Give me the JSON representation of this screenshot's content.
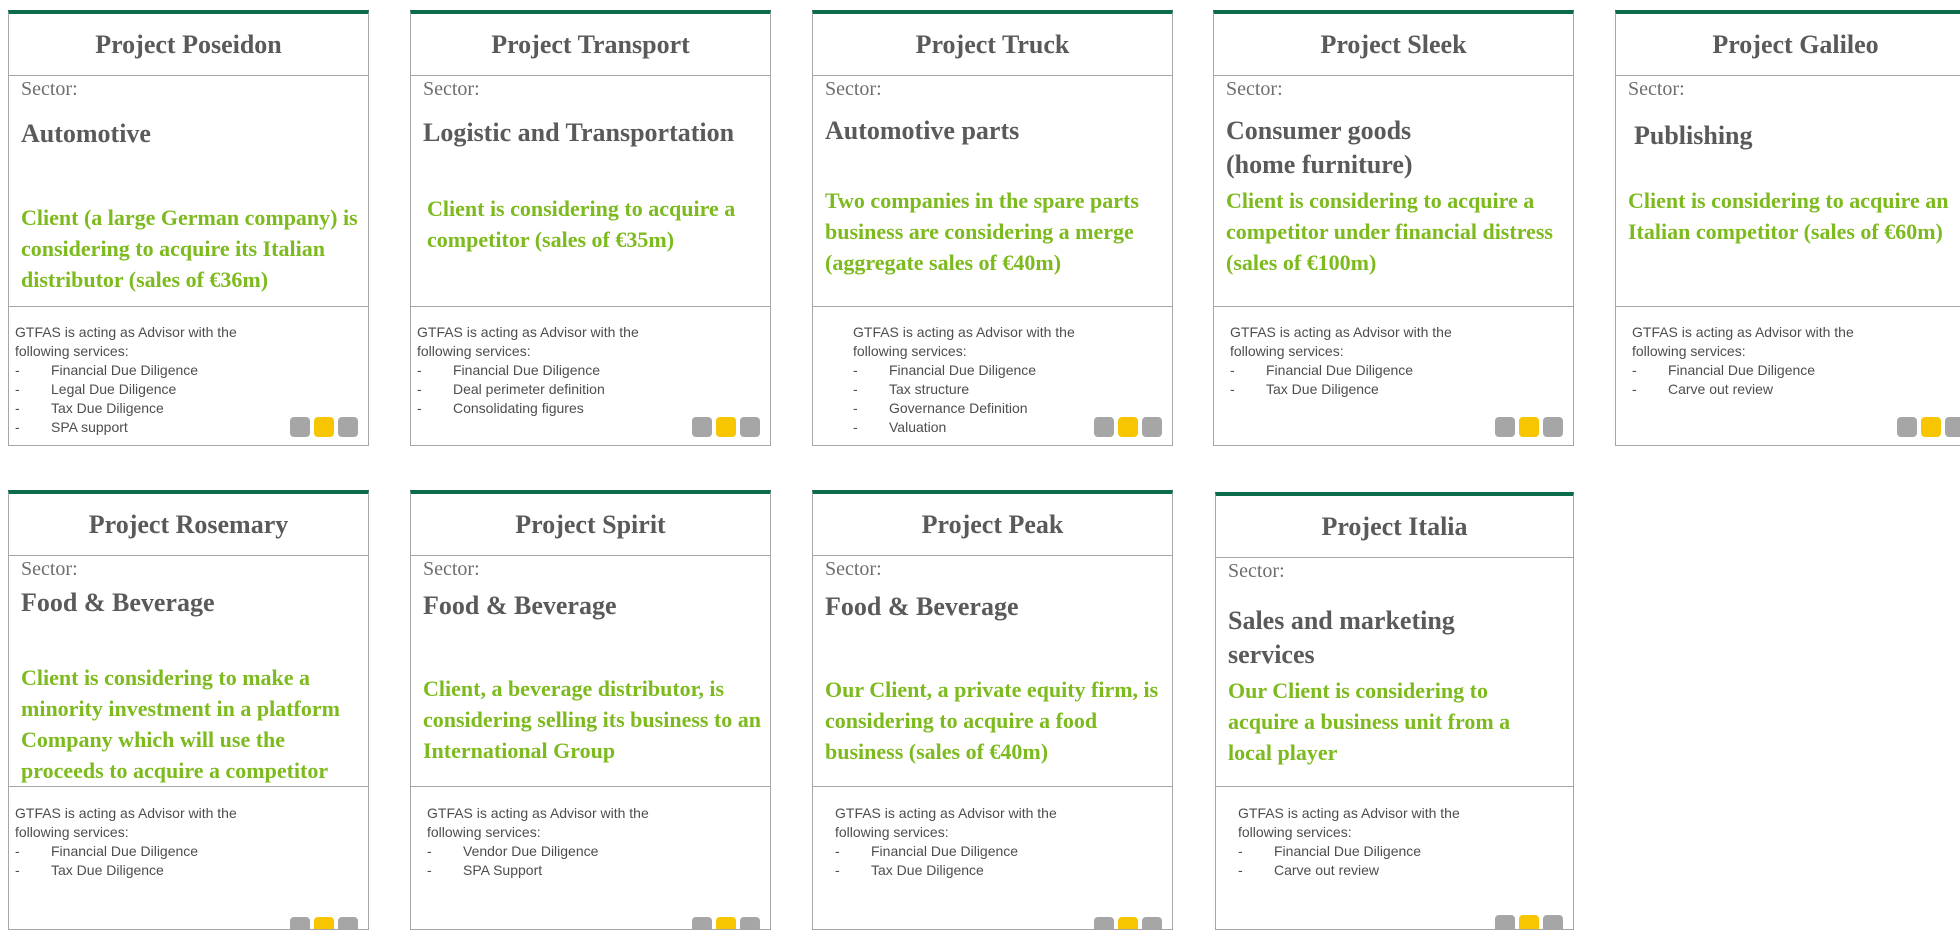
{
  "colors": {
    "accent_green": "#7dba1e",
    "top_bar": "#0b6b4b",
    "dot_grey": "#a6a6a6",
    "dot_yellow": "#f7c600"
  },
  "sector_label": "Sector:",
  "advisor_intro": "GTFAS is acting as Advisor with the following services:",
  "projects": [
    {
      "title": "Project Poseidon",
      "sector": "Automotive",
      "description": "Client (a large German company) is considering to acquire its Italian distributor (sales of €36m)",
      "services": [
        "Financial Due Diligence",
        "Legal Due Diligence",
        "Tax Due Diligence",
        "SPA support"
      ]
    },
    {
      "title": "Project Transport",
      "sector": "Logistic and Transportation",
      "description": "Client is considering to acquire a competitor (sales of €35m)",
      "services": [
        "Financial Due Diligence",
        "Deal perimeter definition",
        "Consolidating figures"
      ]
    },
    {
      "title": "Project Truck",
      "sector": "Automotive parts",
      "description": "Two companies in the spare parts business are considering a merge (aggregate sales of €40m)",
      "services": [
        "Financial Due Diligence",
        "Tax structure",
        "Governance Definition",
        "Valuation"
      ]
    },
    {
      "title": "Project Sleek",
      "sector": "Consumer goods (home furniture)",
      "description": "Client is considering to acquire a competitor under financial distress (sales of €100m)",
      "services": [
        "Financial Due Diligence",
        "Tax Due Diligence"
      ]
    },
    {
      "title": "Project Galileo",
      "sector": "Publishing",
      "description": "Client is considering to acquire an Italian competitor (sales of €60m)",
      "services": [
        "Financial Due Diligence",
        "Carve out review"
      ]
    },
    {
      "title": "Project Rosemary",
      "sector": "Food & Beverage",
      "description": "Client is considering to make a minority investment in a platform Company which will use the proceeds to acquire a competitor",
      "services": [
        "Financial Due Diligence",
        "Tax Due Diligence"
      ]
    },
    {
      "title": "Project Spirit",
      "sector": "Food & Beverage",
      "description": "Client, a beverage distributor, is considering selling its business to an International Group",
      "services": [
        "Vendor Due Diligence",
        "SPA Support"
      ]
    },
    {
      "title": "Project Peak",
      "sector": "Food & Beverage",
      "description": "Our Client, a private equity firm, is considering to acquire a food business (sales of €40m)",
      "services": [
        "Financial Due Diligence",
        "Tax Due Diligence"
      ]
    },
    {
      "title": "Project Italia",
      "sector": "Sales and marketing services",
      "description": "Our Client is considering to acquire a business unit from a local player",
      "services": [
        "Financial Due Diligence",
        "Carve out review"
      ]
    }
  ]
}
